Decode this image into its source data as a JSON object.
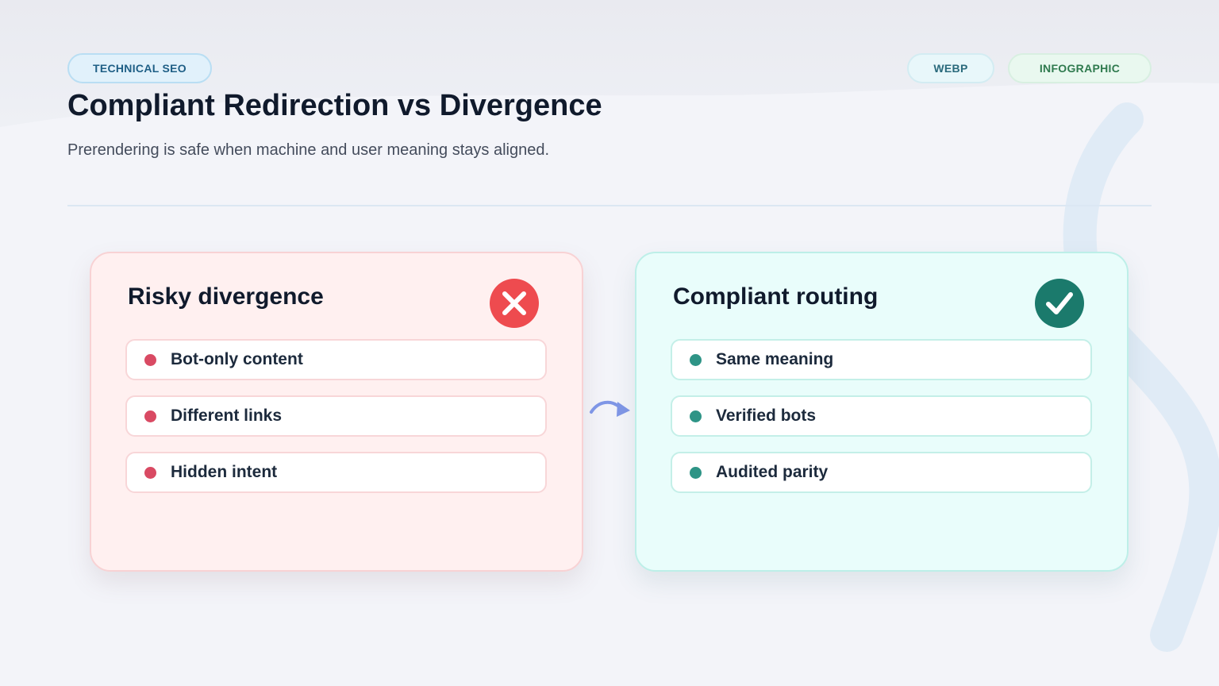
{
  "header": {
    "topic_tag": "TECHNICAL SEO",
    "format_tag": "WEBP",
    "kind_tag": "INFOGRAPHIC",
    "title": "Compliant Redirection vs Divergence",
    "subtitle": "Prerendering is safe when machine and user meaning stays aligned."
  },
  "cards": [
    {
      "title": "Risky divergence",
      "status_icon": "x-mark-icon",
      "accent_color": "#ee4b4f",
      "items": [
        {
          "label": "Bot-only content"
        },
        {
          "label": "Different links"
        },
        {
          "label": "Hidden intent"
        }
      ]
    },
    {
      "title": "Compliant routing",
      "status_icon": "check-mark-icon",
      "accent_color": "#1b7a6c",
      "items": [
        {
          "label": "Same meaning"
        },
        {
          "label": "Verified bots"
        },
        {
          "label": "Audited parity"
        }
      ]
    }
  ],
  "connector_icon": "curved-arrow-right-icon",
  "colors": {
    "risky_card_bg": "#fff0f0",
    "compliant_card_bg": "#e9fdfb",
    "risky_dot": "#d94a63",
    "compliant_dot": "#2e9486",
    "arrow": "#7f96e6"
  }
}
